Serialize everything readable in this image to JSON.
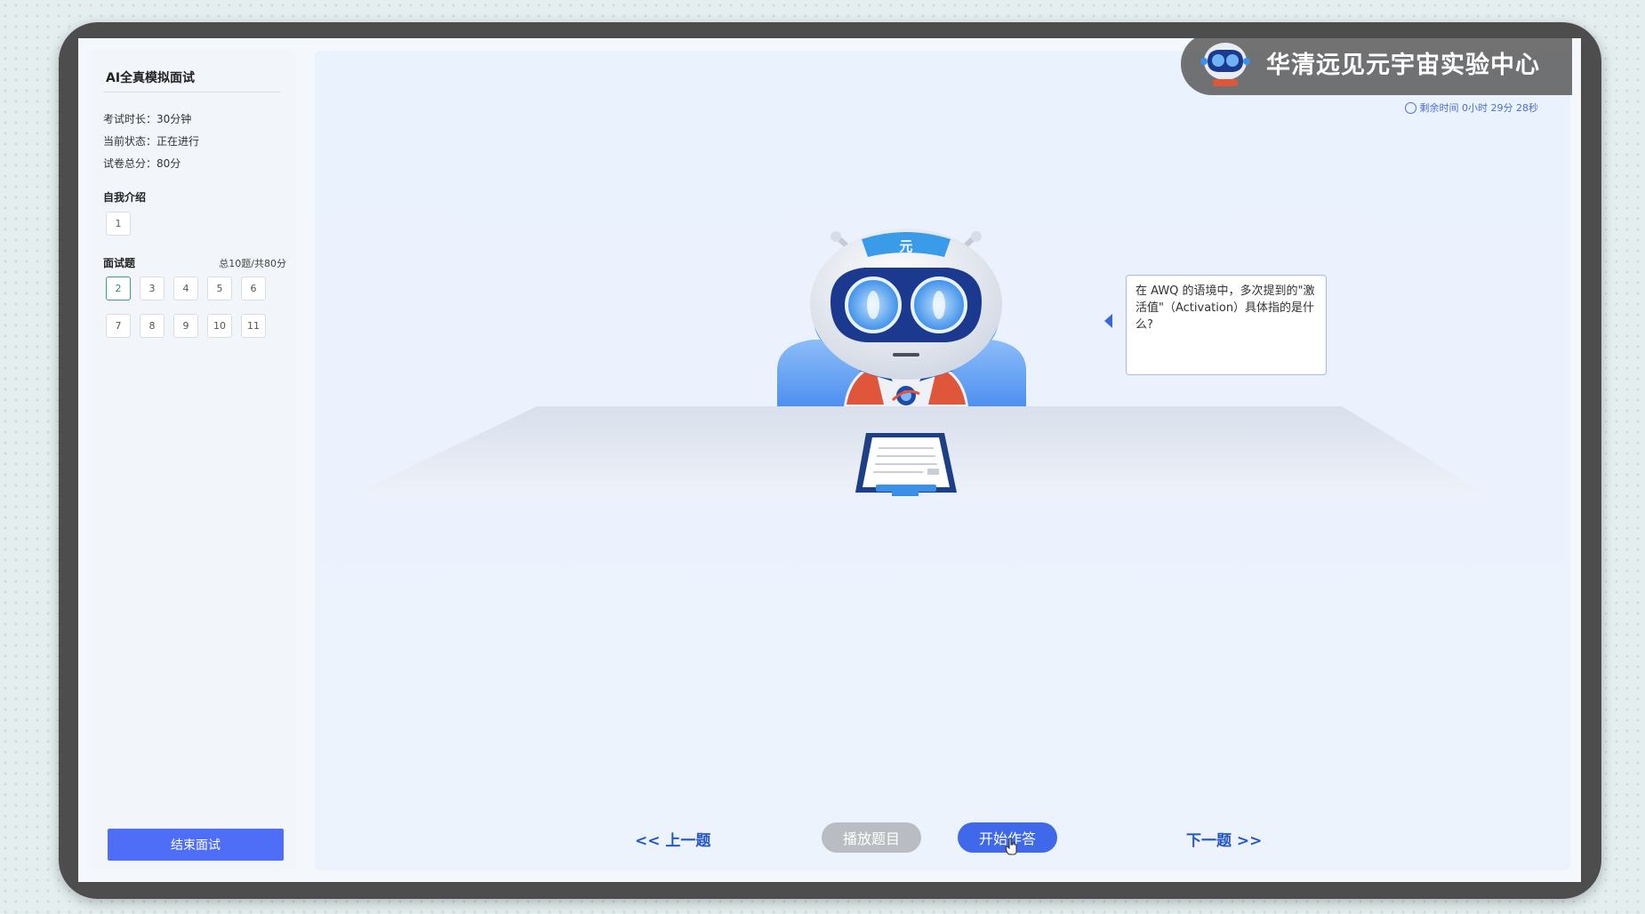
{
  "sidebar": {
    "title": "AI全真模拟面试",
    "duration": "考试时长：30分钟",
    "status": "当前状态：正在进行",
    "total_score": "试卷总分：80分",
    "intro_label": "自我介绍",
    "intro_questions": [
      "1"
    ],
    "interview_label": "面试题",
    "interview_note": "总10题/共80分",
    "interview_questions_row1": [
      "2",
      "3",
      "4",
      "5",
      "6"
    ],
    "interview_questions_row2": [
      "7",
      "8",
      "9",
      "10",
      "11"
    ],
    "active_question": "2",
    "end_button": "结束面试"
  },
  "header": {
    "brand": "华清远见元宇宙实验中心",
    "timer": "剩余时间  0小时 29分 28秒"
  },
  "robot": {
    "badge": "元"
  },
  "speech": {
    "text": "在 AWQ 的语境中，多次提到的\"激活值\"（Activation）具体指的是什么?"
  },
  "controls": {
    "prev": "<< 上一题",
    "play": "播放题目",
    "start": "开始作答",
    "next": "下一题 >>"
  },
  "colors": {
    "accent": "#4f6ef7",
    "active_question": "#3a9e86",
    "disabled": "#b9bcc2",
    "link": "#2457c5"
  }
}
